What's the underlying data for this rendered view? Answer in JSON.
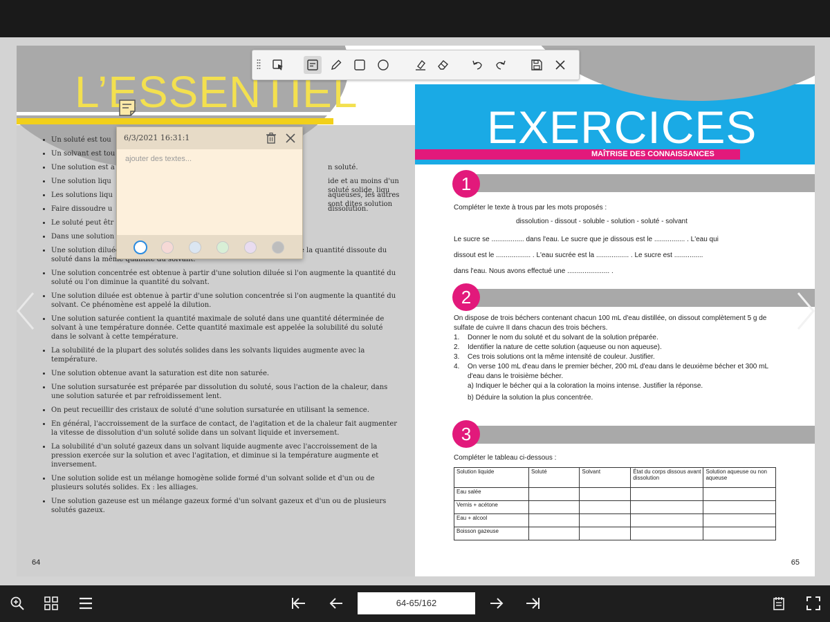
{
  "viewer": {
    "page_indicator": "64-65/162"
  },
  "left_page": {
    "title": "L’ESSENTIEL",
    "page_number": "64",
    "bullets": [
      "Un soluté est tou",
      "Un solvant est tou",
      "Une solution est a",
      "Une solution liqu",
      "Les solutions liqu",
      "Faire dissoudre u",
      "Le soluté peut êtr",
      "Dans une solution",
      "Une solution diluée devient de plus en plus concentrée si l'on augmente la quantité dissoute du soluté dans la même quantité du solvant.",
      "Une solution concentrée est obtenue à partir d'une solution diluée si l'on augmente la quantité du soluté ou l'on diminue la quantité du solvant.",
      "Une solution diluée est obtenue à partir d'une solution concentrée si l'on augmente la quantité du solvant. Ce phénomène est appelé la dilution.",
      "Une solution saturée contient la quantité maximale de soluté dans une quantité déterminée de solvant à une température donnée. Cette quantité maximale est appelée la solubilité du soluté dans le solvant à cette température.",
      "La solubilité de la plupart des solutés solides dans les solvants liquides augmente avec la température.",
      "Une solution obtenue avant la saturation est dite non saturée.",
      "Une solution sursaturée est préparée par dissolution du soluté, sous l'action de la chaleur, dans une solution saturée et par refroidissement lent.",
      "On peut recueillir des cristaux de soluté d'une solution sursaturée en utilisant la semence.",
      "En général, l'accroissement de la surface de contact, de l'agitation et de la chaleur fait augmenter la vitesse de dissolution d'un soluté solide dans un solvant liquide et inversement.",
      "La solubilité d'un soluté gazeux dans un solvant liquide augmente avec l'accroissement de la pression exercée sur la solution et avec l'agitation, et diminue si la température augmente et inversement.",
      "Une solution solide est un mélange homogène solide formé d'un solvant solide et d'un ou de plusieurs solutés solides. Ex : les alliages.",
      "Une solution gazeuse est un mélange gazeux formé d'un solvant gazeux et d'un ou de plusieurs solutés gazeux."
    ],
    "bullet_tails": {
      "2": "n soluté.",
      "3": "ide et au moins d'un soluté solide, liqu",
      "4": "aqueuses, les autres sont dites solution",
      "5": "dissolution."
    }
  },
  "right_page": {
    "title": "EXERCICES",
    "subtitle": "MAÎTRISE DES CONNAISSANCES",
    "page_number": "65",
    "ex1": {
      "num": "1",
      "intro": "Compléter le texte à trous par les mots proposés :",
      "words": "dissolution - dissout - soluble - solution - soluté - solvant",
      "line1": "Le sucre se ................. dans l'eau. Le sucre que je dissous est le ................ . L'eau qui",
      "line2": "dissout est le .................. . L'eau sucrée est la ................. . Le sucre est ...............",
      "line3": "dans l'eau. Nous avons effectué une ...................... ."
    },
    "ex2": {
      "num": "2",
      "intro": "On dispose de trois béchers contenant chacun 100 mL d'eau distillée, on dissout complètement 5 g de sulfate de cuivre II dans chacun des trois béchers.",
      "items": [
        {
          "n": "1.",
          "t": "Donner le nom du soluté et du solvant de la solution préparée."
        },
        {
          "n": "2.",
          "t": "Identifier la nature de cette solution (aqueuse ou non aqueuse)."
        },
        {
          "n": "3.",
          "t": "Ces trois solutions ont la même intensité de couleur. Justifier."
        },
        {
          "n": "4.",
          "t": "On verse 100 mL d'eau dans le premier bécher, 200 mL d'eau dans le deuxième bécher et 300 mL d'eau dans le troisième bécher."
        }
      ],
      "sub_a": "a) Indiquer le bécher qui a la coloration la moins intense. Justifier la réponse.",
      "sub_b": "b) Déduire la solution la plus concentrée."
    },
    "ex3": {
      "num": "3",
      "intro": "Compléter le tableau ci-dessous :",
      "headers": [
        "Solution liquide",
        "Soluté",
        "Solvant",
        "État du corps dissous avant dissolution",
        "Solution aqueuse ou non aqueuse"
      ],
      "rows": [
        "Eau salée",
        "Vernis + acétone",
        "Eau + alcool",
        "Boisson gazeuse"
      ]
    }
  },
  "note": {
    "date": "6/3/2021 16:31:1",
    "placeholder": "ajouter des textes...",
    "swatches": [
      "#ffffff",
      "#f6d9d6",
      "#dbe6f2",
      "#d8efd6",
      "#e9dcf0",
      "#bdbdbd"
    ]
  },
  "colors": {
    "magenta": "#e2197b",
    "cyan": "#1aaae5",
    "yellow": "#f2d01a"
  }
}
